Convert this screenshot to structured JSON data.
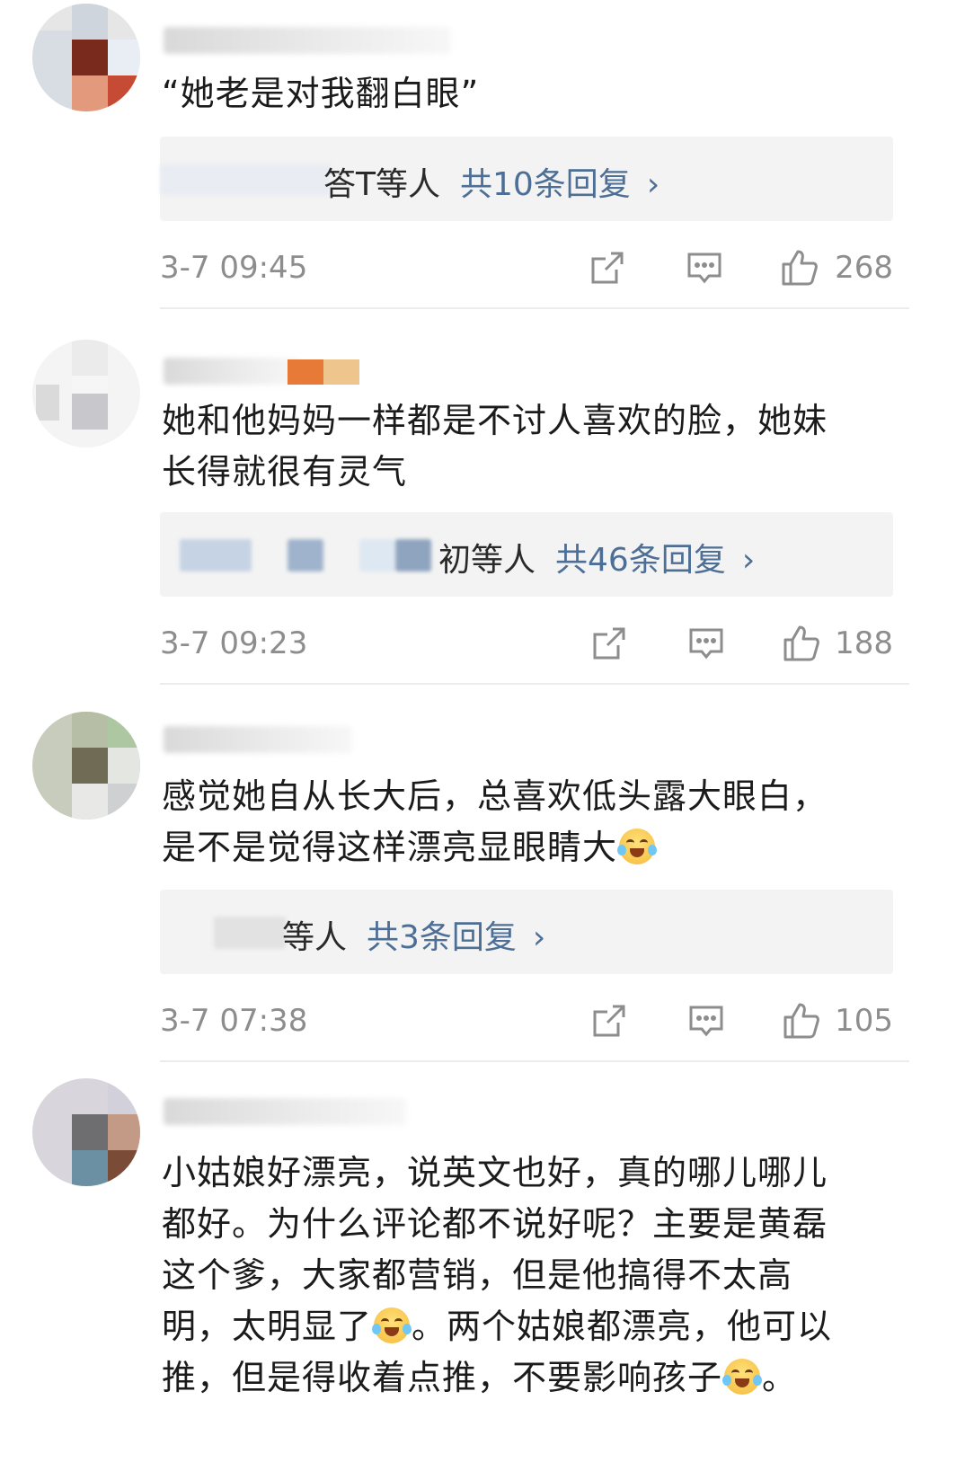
{
  "comments": [
    {
      "text": "“她老是对我翻白眼”",
      "reply_tail": "答T等人",
      "reply_count": "共10条回复",
      "chevron": "›",
      "time": "3-7 09:45",
      "likes": "268"
    },
    {
      "text_line1": "她和他妈妈一样都是不讨人喜欢的脸，她妹",
      "text_line2": "长得就很有灵气",
      "reply_tail": "初等人",
      "reply_count": "共46条回复",
      "chevron": "›",
      "time": "3-7 09:23",
      "likes": "188"
    },
    {
      "text_line1": "感觉她自从长大后，总喜欢低头露大眼白，",
      "text_line2": "是不是觉得这样漂亮显眼睛大",
      "reply_tail": "等人",
      "reply_count": "共3条回复",
      "chevron": "›",
      "time": "3-7 07:38",
      "likes": "105"
    },
    {
      "text_line1": "小姑娘好漂亮，说英文也好，真的哪儿哪儿",
      "text_line2": "都好。为什么评论都不说好呢？主要是黄磊",
      "text_line3": "这个爹，大家都营销，但是他搞得不太高",
      "text_line4a": "明，太明显了",
      "text_line4b": "。两个姑娘都漂亮，他可以",
      "text_line5a": "推，但是得收着点推，不要影响孩子",
      "text_line5b": "。"
    }
  ],
  "icons": {
    "share": "share-icon",
    "comment": "comment-icon",
    "like": "thumbs-up-icon",
    "emoji": "laugh-cry-emoji-icon"
  },
  "colors": {
    "link_blue": "#4d6f96",
    "meta_gray": "#8d8d8d",
    "reply_bg": "#f3f3f3"
  }
}
